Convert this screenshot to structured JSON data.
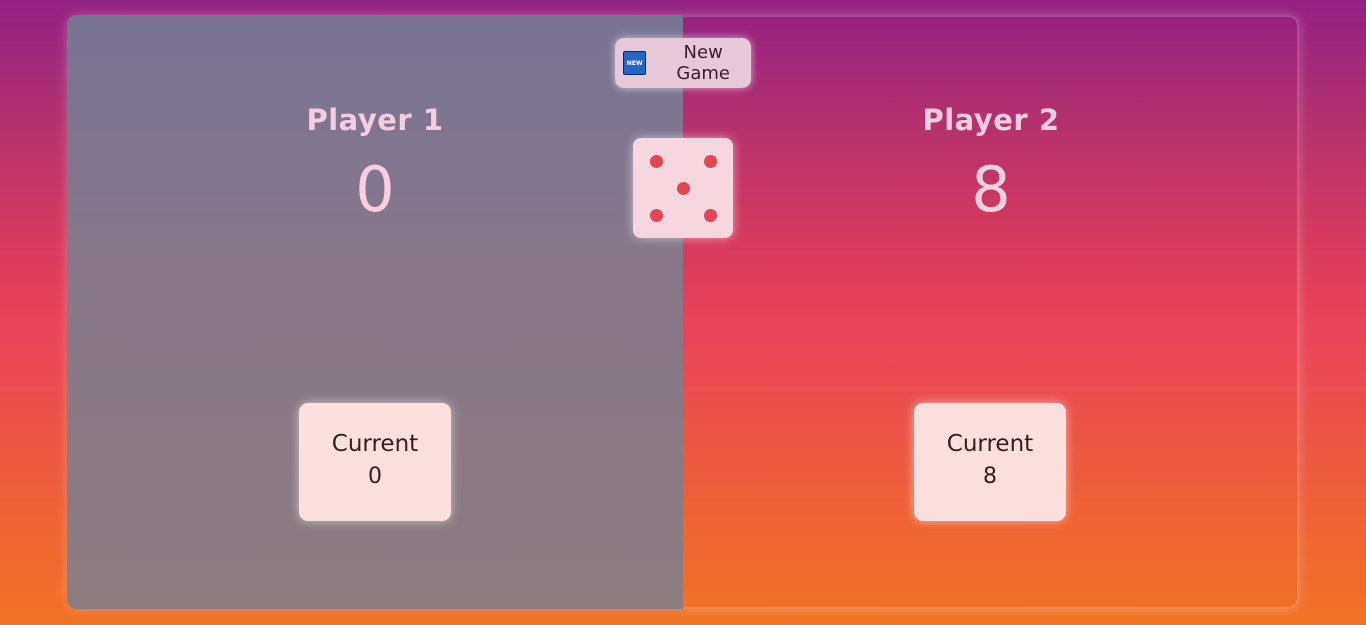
{
  "new_game": {
    "icon_text": "NEW",
    "label": "New Game"
  },
  "dice": {
    "value": 5
  },
  "players": [
    {
      "name": "Player 1",
      "score": "0",
      "current_label": "Current",
      "current": "0",
      "active": true
    },
    {
      "name": "Player 2",
      "score": "8",
      "current_label": "Current",
      "current": "8",
      "active": false
    }
  ],
  "colors": {
    "pip": "#e14556",
    "active_panel": "#877789"
  }
}
